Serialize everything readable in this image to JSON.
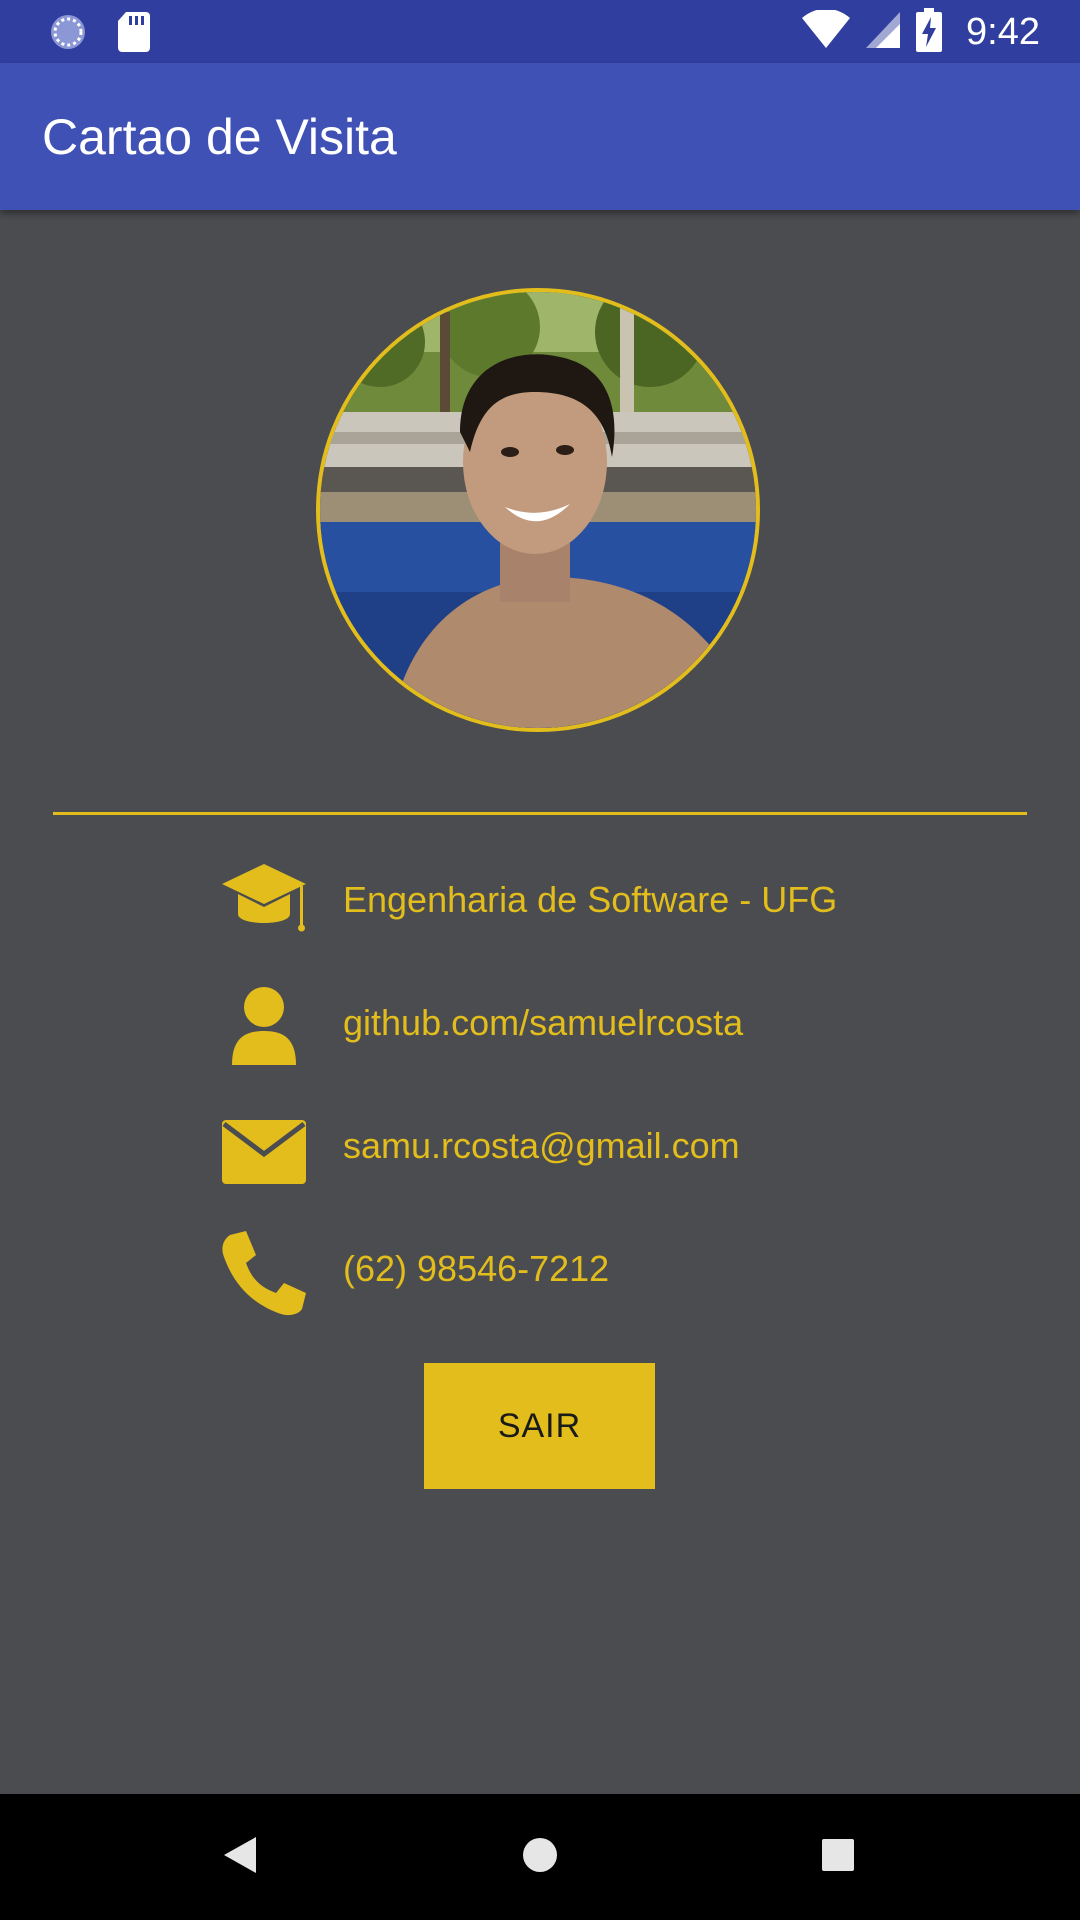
{
  "status_bar": {
    "time": "9:42",
    "icons": [
      "sync-icon",
      "sd-card-icon",
      "wifi-icon",
      "signal-icon",
      "battery-charging-icon"
    ]
  },
  "app_bar": {
    "title": "Cartao de Visita"
  },
  "profile": {
    "avatar_description": "profile-photo"
  },
  "info": {
    "course": "Engenharia de Software - UFG",
    "github": "github.com/samuelrcosta",
    "email": "samu.rcosta@gmail.com",
    "phone": "(62) 98546-7212"
  },
  "actions": {
    "exit_label": "SAIR"
  },
  "nav_bar": {
    "icons": [
      "back-icon",
      "home-icon",
      "recents-icon"
    ]
  },
  "colors": {
    "accent": "#e2bd1c",
    "background": "#4a4c50",
    "app_bar": "#3f51b5",
    "status_bar": "#303f9f"
  }
}
